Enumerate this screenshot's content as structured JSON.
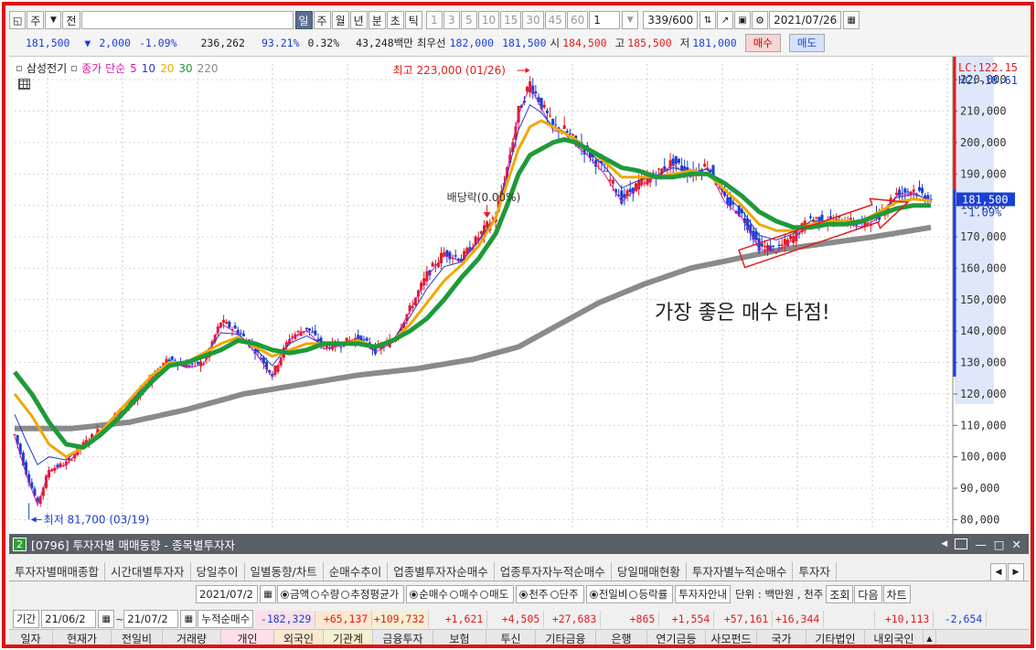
{
  "toolbar": {
    "code_left": "주",
    "code_right": "전",
    "period_buttons": [
      "일",
      "주",
      "월",
      "년",
      "분",
      "초",
      "틱"
    ],
    "selected_period": "일",
    "interval_buttons": [
      "1",
      "3",
      "5",
      "10",
      "15",
      "30",
      "45",
      "60"
    ],
    "interval_select": "1",
    "count_value": "339",
    "count_total": "/600",
    "date_value": "2021/07/26"
  },
  "quote": {
    "price": "181,500",
    "change": "2,000",
    "change_pct": "-1.09%",
    "volume": "236,262",
    "ratio": "93.21%",
    "turnover": "0.32%",
    "amount": "43,248백만",
    "best_label": "최우선",
    "best_ask": "182,000",
    "best_bid": "181,500",
    "open_label": "시",
    "open": "184,500",
    "high_label": "고",
    "high": "185,500",
    "low_label": "저",
    "low": "181,000",
    "buy_label": "매수",
    "sell_label": "매도"
  },
  "legend": {
    "stock": "삼성전기",
    "indicator": "종가 단순",
    "ma": [
      "5",
      "10",
      "20",
      "30",
      "220"
    ]
  },
  "colors": {
    "up": "#e41b1b",
    "down": "#1a3fd4",
    "ma5": "#d41da8",
    "ma10": "#2936c8",
    "ma20": "#f0a800",
    "ma30": "#1e9a3a",
    "ma220": "#8a8a8a"
  },
  "chart_data": {
    "type": "candlestick",
    "y_axis_ticks": [
      "220,000",
      "210,000",
      "200,000",
      "190,000",
      "180,000",
      "170,000",
      "160,000",
      "150,000",
      "140,000",
      "130,000",
      "120,000",
      "110,000",
      "100,000",
      "90,000",
      "80,000"
    ],
    "ylim": [
      77500,
      225000
    ],
    "lc_label": "LC:122.15",
    "hc_label": "HC:-18.61",
    "last_price_label": "181,500",
    "last_change_label": "-1.09%",
    "high_annotation": "최고 223,000 (01/26)",
    "low_annotation": "최저 81,700 (03/19)",
    "dividend_annotation": "배당락(0.00%)",
    "note": "가장 좋은 매수 타점!",
    "price_path": [
      [
        0,
        107000
      ],
      [
        2,
        95000
      ],
      [
        4,
        85000
      ],
      [
        6,
        96000
      ],
      [
        9,
        98000
      ],
      [
        12,
        104000
      ],
      [
        15,
        109000
      ],
      [
        18,
        114000
      ],
      [
        21,
        118000
      ],
      [
        24,
        126000
      ],
      [
        27,
        131000
      ],
      [
        30,
        129000
      ],
      [
        33,
        130000
      ],
      [
        36,
        143000
      ],
      [
        39,
        140000
      ],
      [
        42,
        134000
      ],
      [
        45,
        126000
      ],
      [
        48,
        138000
      ],
      [
        51,
        141000
      ],
      [
        54,
        135000
      ],
      [
        57,
        136000
      ],
      [
        60,
        138000
      ],
      [
        63,
        134000
      ],
      [
        66,
        137000
      ],
      [
        69,
        147000
      ],
      [
        72,
        158000
      ],
      [
        75,
        165000
      ],
      [
        78,
        163000
      ],
      [
        81,
        170000
      ],
      [
        84,
        177000
      ],
      [
        86,
        192000
      ],
      [
        88,
        210000
      ],
      [
        90,
        219000
      ],
      [
        92,
        212000
      ],
      [
        94,
        205000
      ],
      [
        96,
        204000
      ],
      [
        98,
        200000
      ],
      [
        100,
        197000
      ],
      [
        103,
        191000
      ],
      [
        106,
        182000
      ],
      [
        109,
        187000
      ],
      [
        112,
        190000
      ],
      [
        115,
        194000
      ],
      [
        118,
        190000
      ],
      [
        121,
        193000
      ],
      [
        124,
        182000
      ],
      [
        127,
        177000
      ],
      [
        130,
        167000
      ],
      [
        133,
        166000
      ],
      [
        136,
        170000
      ],
      [
        139,
        176000
      ],
      [
        142,
        175000
      ],
      [
        145,
        175000
      ],
      [
        148,
        174000
      ],
      [
        151,
        177000
      ],
      [
        154,
        184000
      ],
      [
        157,
        185000
      ],
      [
        160,
        182000
      ]
    ],
    "ma30_path": [
      [
        0,
        127000
      ],
      [
        3,
        120000
      ],
      [
        6,
        111000
      ],
      [
        9,
        104000
      ],
      [
        12,
        103000
      ],
      [
        15,
        107000
      ],
      [
        18,
        112000
      ],
      [
        21,
        118000
      ],
      [
        24,
        124000
      ],
      [
        27,
        129000
      ],
      [
        30,
        130000
      ],
      [
        33,
        132000
      ],
      [
        36,
        134000
      ],
      [
        39,
        137000
      ],
      [
        42,
        136000
      ],
      [
        45,
        134000
      ],
      [
        48,
        133000
      ],
      [
        51,
        134000
      ],
      [
        54,
        136000
      ],
      [
        57,
        136000
      ],
      [
        60,
        136000
      ],
      [
        63,
        135000
      ],
      [
        66,
        137000
      ],
      [
        69,
        140000
      ],
      [
        72,
        144000
      ],
      [
        75,
        150000
      ],
      [
        78,
        157000
      ],
      [
        81,
        163000
      ],
      [
        84,
        171000
      ],
      [
        86,
        180000
      ],
      [
        88,
        190000
      ],
      [
        90,
        196000
      ],
      [
        92,
        198000
      ],
      [
        94,
        200000
      ],
      [
        96,
        201000
      ],
      [
        98,
        200000
      ],
      [
        100,
        198000
      ],
      [
        103,
        195000
      ],
      [
        106,
        192000
      ],
      [
        109,
        191000
      ],
      [
        112,
        189000
      ],
      [
        115,
        189000
      ],
      [
        118,
        190000
      ],
      [
        121,
        190000
      ],
      [
        124,
        187000
      ],
      [
        127,
        183000
      ],
      [
        130,
        178000
      ],
      [
        133,
        175000
      ],
      [
        136,
        173000
      ],
      [
        139,
        173000
      ],
      [
        142,
        174000
      ],
      [
        145,
        174000
      ],
      [
        148,
        175000
      ],
      [
        151,
        177000
      ],
      [
        154,
        179000
      ],
      [
        157,
        180000
      ],
      [
        160,
        180000
      ]
    ],
    "ma20_path": [
      [
        0,
        120000
      ],
      [
        3,
        113000
      ],
      [
        6,
        104000
      ],
      [
        9,
        100000
      ],
      [
        12,
        103000
      ],
      [
        15,
        108000
      ],
      [
        18,
        114000
      ],
      [
        21,
        120000
      ],
      [
        24,
        126000
      ],
      [
        27,
        130000
      ],
      [
        30,
        130000
      ],
      [
        33,
        133000
      ],
      [
        36,
        136000
      ],
      [
        39,
        138000
      ],
      [
        42,
        135000
      ],
      [
        45,
        132000
      ],
      [
        48,
        134000
      ],
      [
        51,
        136000
      ],
      [
        54,
        136000
      ],
      [
        57,
        136000
      ],
      [
        60,
        137000
      ],
      [
        63,
        135000
      ],
      [
        66,
        137000
      ],
      [
        69,
        142000
      ],
      [
        72,
        149000
      ],
      [
        75,
        156000
      ],
      [
        78,
        161000
      ],
      [
        81,
        167000
      ],
      [
        84,
        176000
      ],
      [
        86,
        187000
      ],
      [
        88,
        198000
      ],
      [
        90,
        205000
      ],
      [
        92,
        207000
      ],
      [
        94,
        205000
      ],
      [
        96,
        203000
      ],
      [
        98,
        201000
      ],
      [
        100,
        198000
      ],
      [
        103,
        194000
      ],
      [
        106,
        189000
      ],
      [
        109,
        189000
      ],
      [
        112,
        189000
      ],
      [
        115,
        190000
      ],
      [
        118,
        191000
      ],
      [
        121,
        190000
      ],
      [
        124,
        185000
      ],
      [
        127,
        180000
      ],
      [
        130,
        174000
      ],
      [
        133,
        172000
      ],
      [
        136,
        172000
      ],
      [
        139,
        174000
      ],
      [
        142,
        175000
      ],
      [
        145,
        175000
      ],
      [
        148,
        175000
      ],
      [
        151,
        178000
      ],
      [
        154,
        181000
      ],
      [
        157,
        182000
      ],
      [
        160,
        181500
      ]
    ],
    "ma220_path": [
      [
        0,
        109000
      ],
      [
        10,
        109000
      ],
      [
        20,
        111000
      ],
      [
        30,
        115000
      ],
      [
        40,
        120000
      ],
      [
        50,
        123000
      ],
      [
        60,
        126000
      ],
      [
        70,
        128000
      ],
      [
        80,
        131000
      ],
      [
        88,
        135000
      ],
      [
        95,
        142000
      ],
      [
        102,
        149000
      ],
      [
        110,
        155000
      ],
      [
        118,
        160000
      ],
      [
        126,
        163000
      ],
      [
        134,
        166000
      ],
      [
        142,
        168000
      ],
      [
        150,
        170000
      ],
      [
        160,
        173000
      ]
    ]
  },
  "panel": {
    "window_num": "2",
    "title": "[0796] 투자자별 매매동향 - 종목별투자자",
    "tabs": [
      "투자자별매매종합",
      "시간대별투자자",
      "당일추이",
      "일별동향/차트",
      "순매수추이",
      "업종별투자자순매수",
      "업종투자자누적순매수",
      "당일매매현황",
      "투자자별누적순매수",
      "투자자"
    ],
    "date_field": "2021/07/2",
    "options": [
      {
        "label": "금액",
        "on": true
      },
      {
        "label": "수량",
        "on": false
      },
      {
        "label": "추정평균가",
        "on": false
      },
      {
        "label": "순매수",
        "on": true
      },
      {
        "label": "매수",
        "on": false
      },
      {
        "label": "매도",
        "on": false
      },
      {
        "label": "천주",
        "on": true
      },
      {
        "label": "단주",
        "on": false
      },
      {
        "label": "전일비",
        "on": true
      },
      {
        "label": "등락률",
        "on": false
      }
    ],
    "guide_button": "투자자안내",
    "unit_label": "단위 : 백만원 , 천주",
    "query_button": "조회",
    "next_button": "다음",
    "chart_button": "차트",
    "period_label": "기간",
    "period_from": "21/06/2",
    "period_to": "21/07/2",
    "cum_label": "누적순매수",
    "sums": [
      "-182,329",
      "+65,137",
      "+109,732",
      "+1,621",
      "+4,505",
      "+27,683",
      "+865",
      "+1,554",
      "+57,161",
      "+16,344",
      "",
      "+10,113",
      "-2,654"
    ],
    "headers": [
      "일자",
      "현재가",
      "전일비",
      "거래량",
      "개인",
      "외국인",
      "기관계",
      "금융투자",
      "보험",
      "투신",
      "기타금융",
      "은행",
      "연기금등",
      "사모펀드",
      "국가",
      "기타법인",
      "내외국인"
    ]
  }
}
